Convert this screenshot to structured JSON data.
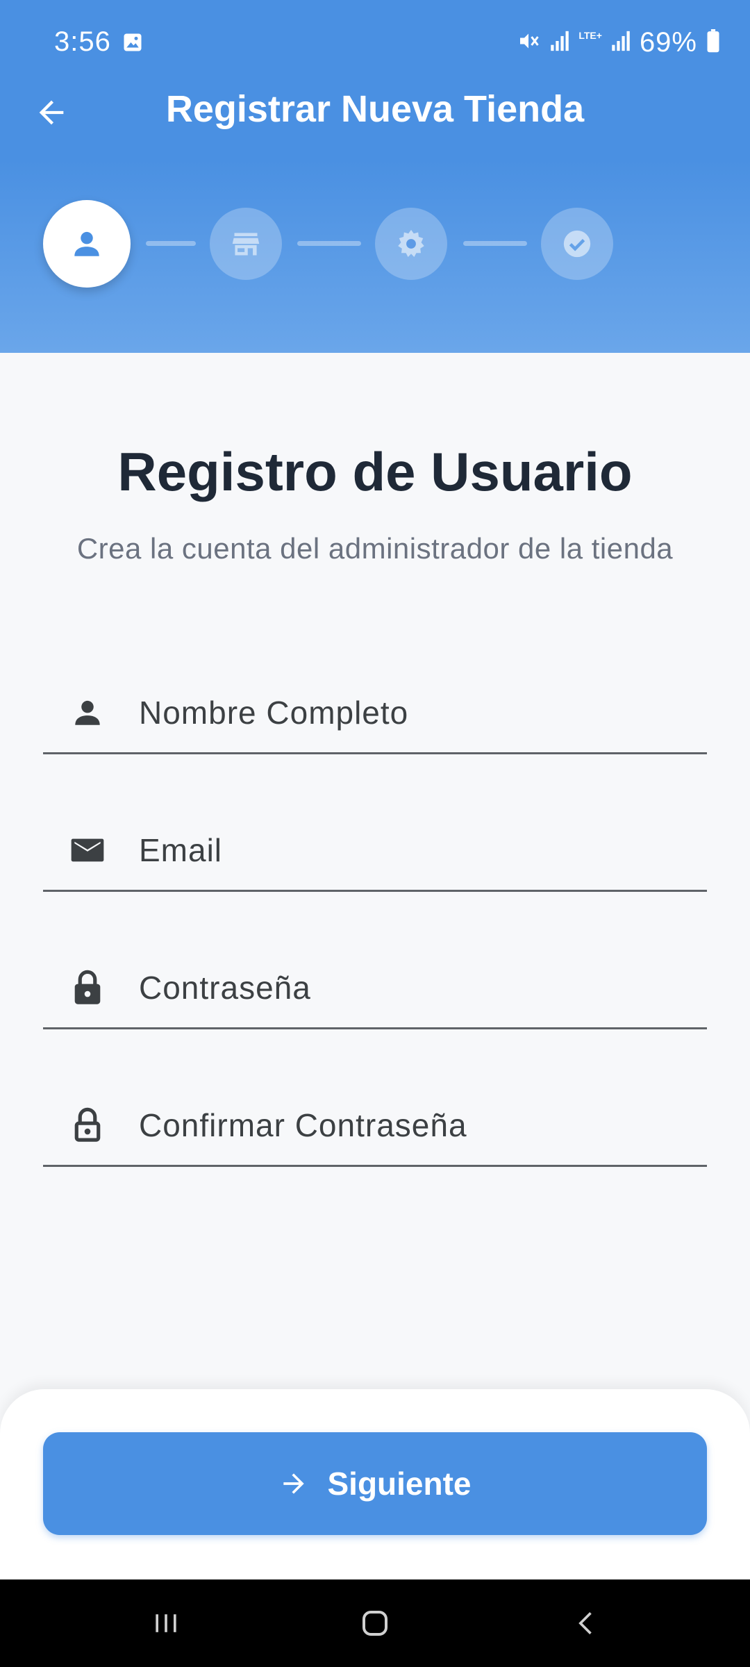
{
  "status_bar": {
    "time": "3:56",
    "network_label": "LTE+",
    "battery": "69%"
  },
  "app_bar": {
    "title": "Registrar Nueva Tienda",
    "back_icon": "arrow-back-icon"
  },
  "stepper": {
    "steps": [
      {
        "icon": "person-icon",
        "state": "active"
      },
      {
        "icon": "store-icon",
        "state": "inactive"
      },
      {
        "icon": "settings-icon",
        "state": "inactive"
      },
      {
        "icon": "check-circle-icon",
        "state": "inactive"
      }
    ]
  },
  "form": {
    "title": "Registro de Usuario",
    "subtitle": "Crea la cuenta del administrador de la tienda",
    "fields": {
      "name": {
        "placeholder": "Nombre Completo",
        "value": "",
        "icon": "person-icon"
      },
      "email": {
        "placeholder": "Email",
        "value": "",
        "icon": "mail-icon"
      },
      "password": {
        "placeholder": "Contraseña",
        "value": "",
        "icon": "lock-icon"
      },
      "confirm_password": {
        "placeholder": "Confirmar Contraseña",
        "value": "",
        "icon": "lock-outline-icon"
      }
    }
  },
  "actions": {
    "next_label": "Siguiente",
    "next_icon": "arrow-forward-icon"
  },
  "colors": {
    "primary": "#4a90e2",
    "background": "#f7f8fa",
    "title_text": "#1f2937",
    "subtitle_text": "#6b7280",
    "field_text": "#3c4043"
  }
}
